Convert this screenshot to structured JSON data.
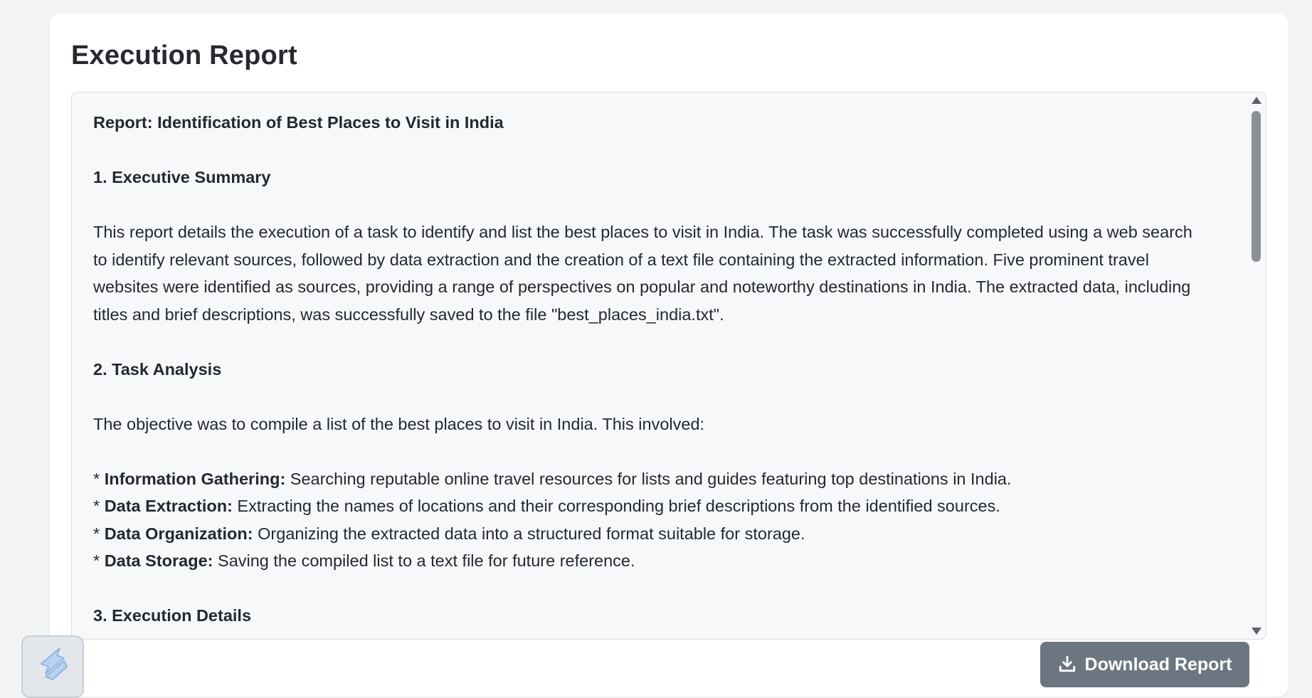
{
  "page": {
    "title": "Execution Report"
  },
  "report": {
    "heading": "Report: Identification of Best Places to Visit in India",
    "section1_title": "1. Executive Summary",
    "summary_lines": [
      "This report details the execution of a task to identify and list the best places to visit in India.  The task was successfully completed using a web search",
      "to identify relevant sources, followed by data extraction and the creation of a text file containing the extracted information.  Five prominent travel",
      "websites were identified as sources, providing a range of perspectives on popular and noteworthy destinations in India.  The extracted data, including",
      "titles and brief descriptions, was successfully saved to the file \"best_places_india.txt\"."
    ],
    "section2_title": "2. Task Analysis",
    "objective": "The objective was to compile a list of the best places to visit in India. This involved:",
    "bullets": [
      {
        "marker": "* ",
        "label": "Information Gathering:",
        "text": " Searching reputable online travel resources for lists and guides featuring top destinations in India."
      },
      {
        "marker": "* ",
        "label": "Data Extraction:",
        "text": " Extracting the names of locations and their corresponding brief descriptions from the identified sources."
      },
      {
        "marker": "* ",
        "label": "Data Organization:",
        "text": " Organizing the extracted data into a structured format suitable for storage."
      },
      {
        "marker": "* ",
        "label": "Data Storage:",
        "text": " Saving the compiled list to a text file for future reference."
      }
    ],
    "section3_title": "3. Execution Details"
  },
  "actions": {
    "download_label": "Download Report"
  },
  "icons": {
    "download": "download-icon",
    "widget": "app-logo-icon"
  },
  "colors": {
    "button_bg": "#6c7680",
    "report_bg": "#f6f8fa",
    "page_bg": "#f3f4f6"
  }
}
